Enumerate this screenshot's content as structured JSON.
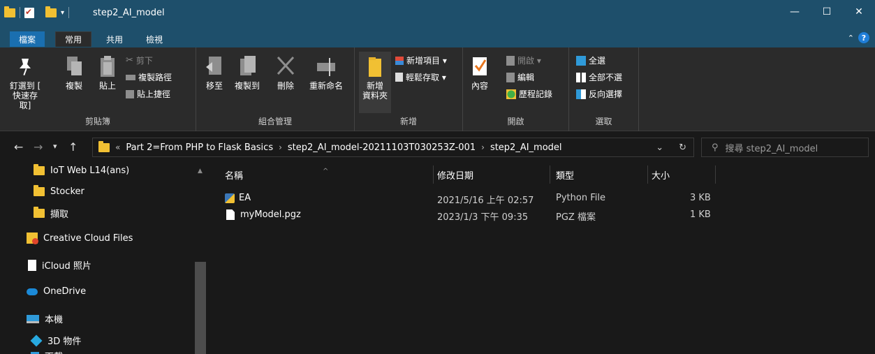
{
  "window": {
    "title": "step2_AI_model",
    "controls": {
      "minimize": "—",
      "maximize": "☐",
      "close": "✕"
    }
  },
  "tabs": {
    "file": "檔案",
    "home": "常用",
    "share": "共用",
    "view": "檢視"
  },
  "ribbon": {
    "clipboard": {
      "label": "剪貼簿",
      "pin_label_1": "釘選到 [",
      "pin_label_2": "快速存取]",
      "copy": "複製",
      "paste": "貼上",
      "cut": "剪下",
      "copy_path": "複製路徑",
      "paste_shortcut": "貼上捷徑"
    },
    "organize": {
      "label": "組合管理",
      "move_to": "移至",
      "copy_to": "複製到",
      "delete": "刪除",
      "rename": "重新命名"
    },
    "new": {
      "label": "新增",
      "new_folder_1": "新增",
      "new_folder_2": "資料夾",
      "new_item": "新增項目 ▾",
      "easy_access": "輕鬆存取 ▾"
    },
    "open": {
      "label": "開啟",
      "properties": "內容",
      "open": "開啟 ▾",
      "edit": "編輯",
      "history": "歷程記錄"
    },
    "select": {
      "label": "選取",
      "select_all": "全選",
      "select_none": "全部不選",
      "invert": "反向選擇"
    }
  },
  "address": {
    "prefix": "«",
    "segments": [
      "Part 2=From PHP to Flask Basics",
      "step2_AI_model-20211103T030253Z-001",
      "step2_AI_model"
    ],
    "search_placeholder": "搜尋 step2_AI_model"
  },
  "navpane": {
    "items": [
      "IoT Web L14(ans)",
      "Stocker",
      "擷取",
      "Creative Cloud Files",
      "iCloud 照片",
      "OneDrive",
      "本機",
      "3D 物件",
      "下載"
    ]
  },
  "columns": {
    "name": "名稱",
    "modified": "修改日期",
    "type": "類型",
    "size": "大小"
  },
  "files": [
    {
      "name": "EA",
      "modified": "2021/5/16 上午 02:57",
      "type": "Python File",
      "size": "3 KB",
      "icon": "python-file-icon"
    },
    {
      "name": "myModel.pgz",
      "modified": "2023/1/3 下午 09:35",
      "type": "PGZ 檔案",
      "size": "1 KB",
      "icon": "generic-file-icon"
    }
  ],
  "colors": {
    "titlebar": "#1e4f6b",
    "background": "#191919",
    "ribbon": "#2b2b2b",
    "folder": "#f1c033",
    "accent": "#1a6fb0"
  }
}
